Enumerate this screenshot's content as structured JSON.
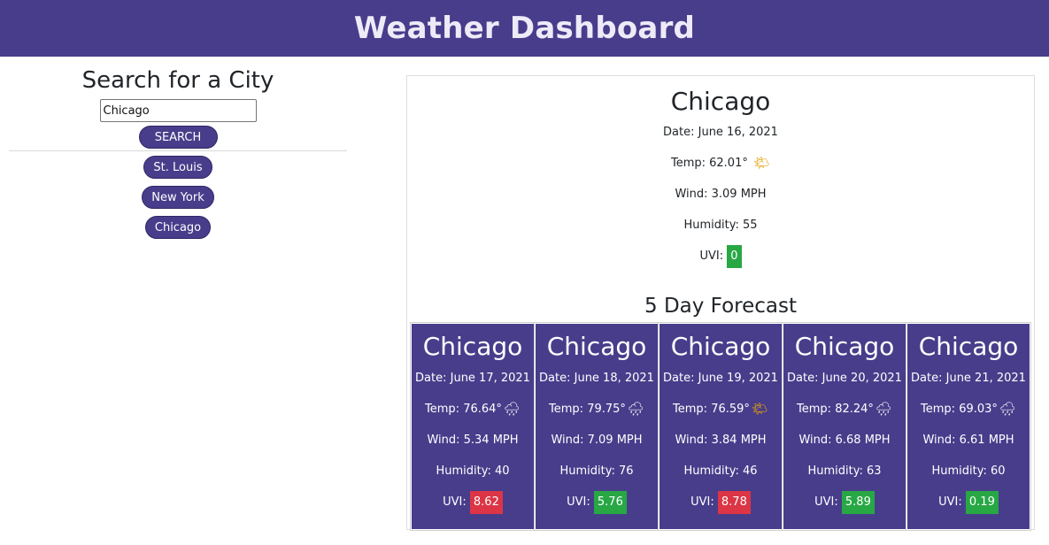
{
  "header": {
    "title": "Weather Dashboard"
  },
  "search": {
    "heading": "Search for a City",
    "input_value": "Chicago",
    "button_label": "SEARCH"
  },
  "history": [
    {
      "label": "St. Louis"
    },
    {
      "label": "New York"
    },
    {
      "label": "Chicago"
    }
  ],
  "current": {
    "city": "Chicago",
    "date": "Date: June 16, 2021",
    "temp": "Temp: 62.01°",
    "icon": "sun-icon",
    "wind": "Wind: 3.09 MPH",
    "humidity": "Humidity: 55",
    "uvi_label": "UVI:",
    "uvi_value": "0",
    "uvi_color": "#28a745"
  },
  "forecast_title": "5 Day Forecast",
  "forecast": [
    {
      "city": "Chicago",
      "date": "Date: June 17, 2021",
      "temp": "Temp: 76.64°",
      "icon": "rain-cloud-icon",
      "wind": "Wind: 5.34 MPH",
      "humidity": "Humidity: 40",
      "uvi_label": "UVI:",
      "uvi_value": "8.62",
      "uvi_color": "#dc3545"
    },
    {
      "city": "Chicago",
      "date": "Date: June 18, 2021",
      "temp": "Temp: 79.75°",
      "icon": "rain-cloud-icon",
      "wind": "Wind: 7.09 MPH",
      "humidity": "Humidity: 76",
      "uvi_label": "UVI:",
      "uvi_value": "5.76",
      "uvi_color": "#28a745"
    },
    {
      "city": "Chicago",
      "date": "Date: June 19, 2021",
      "temp": "Temp: 76.59°",
      "icon": "sun-icon",
      "wind": "Wind: 3.84 MPH",
      "humidity": "Humidity: 46",
      "uvi_label": "UVI:",
      "uvi_value": "8.78",
      "uvi_color": "#dc3545"
    },
    {
      "city": "Chicago",
      "date": "Date: June 20, 2021",
      "temp": "Temp: 82.24°",
      "icon": "rain-cloud-icon",
      "wind": "Wind: 6.68 MPH",
      "humidity": "Humidity: 63",
      "uvi_label": "UVI:",
      "uvi_value": "5.89",
      "uvi_color": "#28a745"
    },
    {
      "city": "Chicago",
      "date": "Date: June 21, 2021",
      "temp": "Temp: 69.03°",
      "icon": "rain-cloud-icon",
      "wind": "Wind: 6.61 MPH",
      "humidity": "Humidity: 60",
      "uvi_label": "UVI:",
      "uvi_value": "0.19",
      "uvi_color": "#28a745"
    }
  ],
  "colors": {
    "accent": "#483d8b",
    "uvi_low": "#28a745",
    "uvi_high": "#dc3545"
  }
}
